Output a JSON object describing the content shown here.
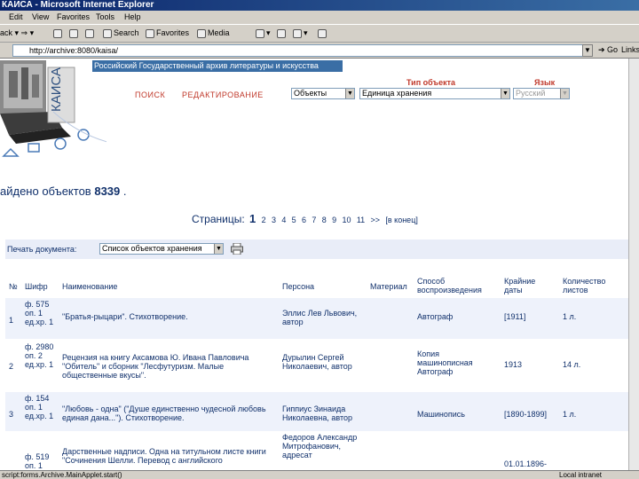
{
  "window": {
    "title": "КАИСА - Microsoft Internet Explorer"
  },
  "menu": [
    "Edit",
    "View",
    "Favorites",
    "Tools",
    "Help"
  ],
  "toolbar": {
    "back": "ack",
    "search": "Search",
    "favorites": "Favorites",
    "media": "Media"
  },
  "address": {
    "url": "http://archive:8080/kaisa/",
    "go": "Go",
    "links": "Links"
  },
  "banner": {
    "text": "Российский Государственный архив литературы и искусства",
    "logo_text": "КАИСА"
  },
  "nav": {
    "search": "ПОИСК",
    "edit": "РЕДАКТИРОВАНИЕ"
  },
  "filters": {
    "object_type_label": "Тип объекта",
    "language_label": "Язык",
    "scope": "Объекты",
    "object_type": "Единица хранения",
    "language": "Русский"
  },
  "results": {
    "found_text": "айдено объектов",
    "count": "8339",
    "dot": "."
  },
  "pagination": {
    "label": "Страницы:",
    "current": "1",
    "pages": [
      "2",
      "3",
      "4",
      "5",
      "6",
      "7",
      "8",
      "9",
      "10",
      "11"
    ],
    "next": ">>",
    "last": "в конец"
  },
  "print": {
    "label": "Печать документа:",
    "option": "Список объектов хранения"
  },
  "table": {
    "headers": {
      "num": "№",
      "code": "Шифр",
      "title": "Наименование",
      "person": "Персона",
      "material": "Материал",
      "method": "Способ воспроизведения",
      "dates": "Крайние даты",
      "count": "Количество листов"
    },
    "rows": [
      {
        "num": "1",
        "code": "ф. 575 оп. 1 ед.хр. 1",
        "title": "\"Братья-рыцари\". Стихотворение.",
        "person": "Эллис Лев Львович, автор",
        "material": "",
        "method": "Автограф",
        "dates": "[1911]",
        "count": "1 л."
      },
      {
        "num": "2",
        "code": "ф. 2980 оп. 2 ед.хр. 1",
        "title": "Рецензия на книгу Аксамова Ю. Ивана Павловича \"Обитель\" и сборник \"Лесфутуризм. Малые общественные вкусы\".",
        "person": "Дурылин Сергей Николаевич, автор",
        "material": "",
        "method": "Копия машинописная Автограф",
        "dates": "1913",
        "count": "14 л."
      },
      {
        "num": "3",
        "code": "ф. 154 оп. 1 ед.хр. 1",
        "title": "\"Любовь - одна\" (\"Душе единственно чудесной любовь единая дана...\"). Стихотворение.",
        "person": "Гиппиус Зинаида Николаевна, автор",
        "material": "",
        "method": "Машинопись",
        "dates": "[1890-1899]",
        "count": "1 л."
      },
      {
        "num": "",
        "code": "ф. 519 оп. 1",
        "title": "Дарственные надписи. Одна на титульном листе книги \"Сочинения Шелли. Перевод с английского",
        "person": "Федоров Александр Митрофанович, адресат",
        "material": "",
        "method": "",
        "dates": "01.01.1896-",
        "count": ""
      }
    ]
  },
  "status": {
    "left": "script:forms.Archive.MainApplet.start()",
    "zone": "Local intranet"
  }
}
